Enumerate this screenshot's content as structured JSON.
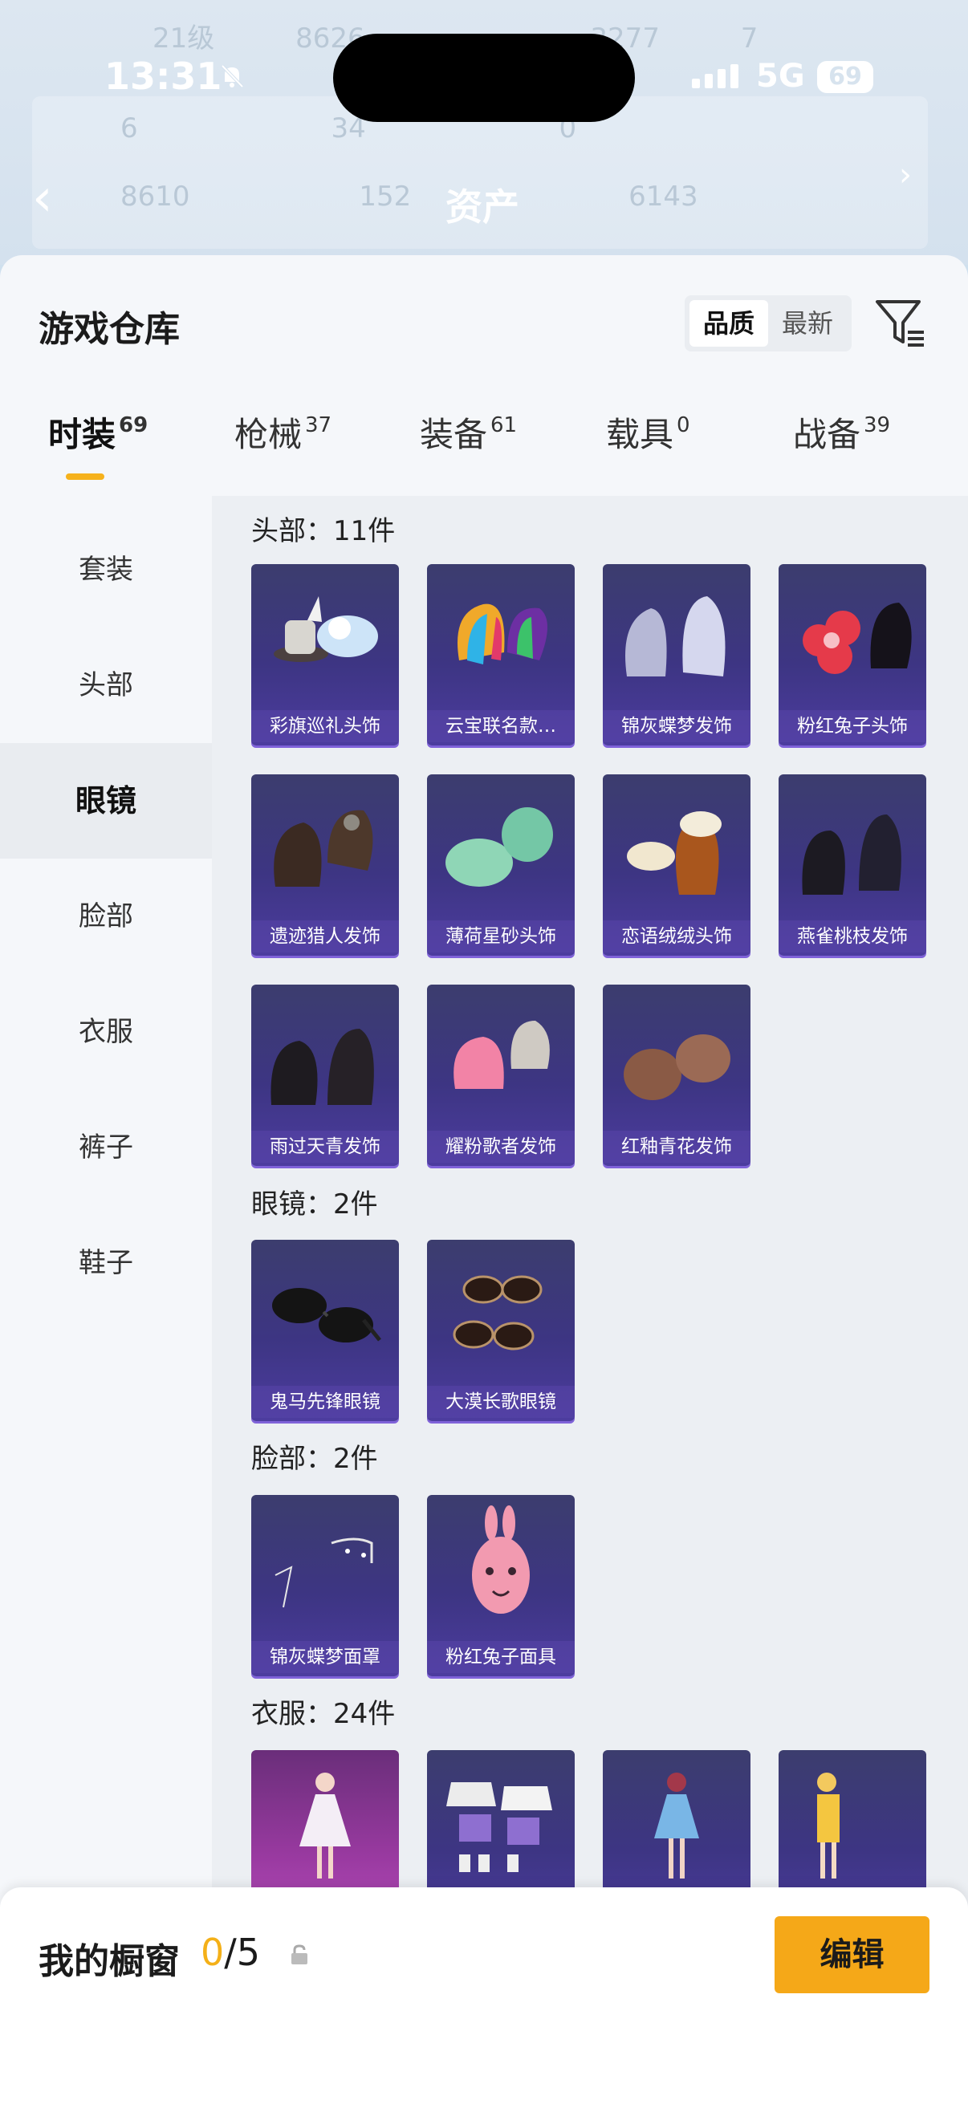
{
  "status_bar": {
    "time": "13:31",
    "network": "5G",
    "battery": "69"
  },
  "header": {
    "title": "资产",
    "background_stats_row1": [
      "21级",
      "8626",
      "3277",
      "7"
    ],
    "background_stats_row2": [
      "6",
      "34",
      "0"
    ],
    "background_stats_row3": [
      "8610",
      "152",
      "6143"
    ]
  },
  "warehouse": {
    "title": "游戏仓库",
    "sort_options": [
      "品质",
      "最新"
    ],
    "sort_selected": "品质"
  },
  "tabs": [
    {
      "label": "时装",
      "count": "69",
      "active": true
    },
    {
      "label": "枪械",
      "count": "37"
    },
    {
      "label": "装备",
      "count": "61"
    },
    {
      "label": "载具",
      "count": "0"
    },
    {
      "label": "战备",
      "count": "39"
    }
  ],
  "categories": [
    "套装",
    "头部",
    "眼镜",
    "脸部",
    "衣服",
    "裤子",
    "鞋子"
  ],
  "category_selected": "眼镜",
  "sections": [
    {
      "title": "头部：11件",
      "items": [
        "彩旗巡礼头饰",
        "云宝联名款…",
        "锦灰蝶梦发饰",
        "粉红兔子头饰",
        "遗迹猎人发饰",
        "薄荷星砂头饰",
        "恋语绒绒头饰",
        "燕雀桃枝发饰",
        "雨过天青发饰",
        "耀粉歌者发饰",
        "红釉青花发饰"
      ]
    },
    {
      "title": "眼镜：2件",
      "items": [
        "鬼马先锋眼镜",
        "大漠长歌眼镜"
      ]
    },
    {
      "title": "脸部：2件",
      "items": [
        "锦灰蝶梦面罩",
        "粉红兔子面具"
      ]
    },
    {
      "title": "衣服：24件",
      "items": [
        "",
        "",
        "",
        ""
      ]
    }
  ],
  "showcase": {
    "label": "我的橱窗",
    "current": "0",
    "total": "/5",
    "edit_label": "编辑"
  },
  "colors": {
    "accent": "#f4a818",
    "item_bg": "#3d3583",
    "item_border": "#7f62d9"
  }
}
